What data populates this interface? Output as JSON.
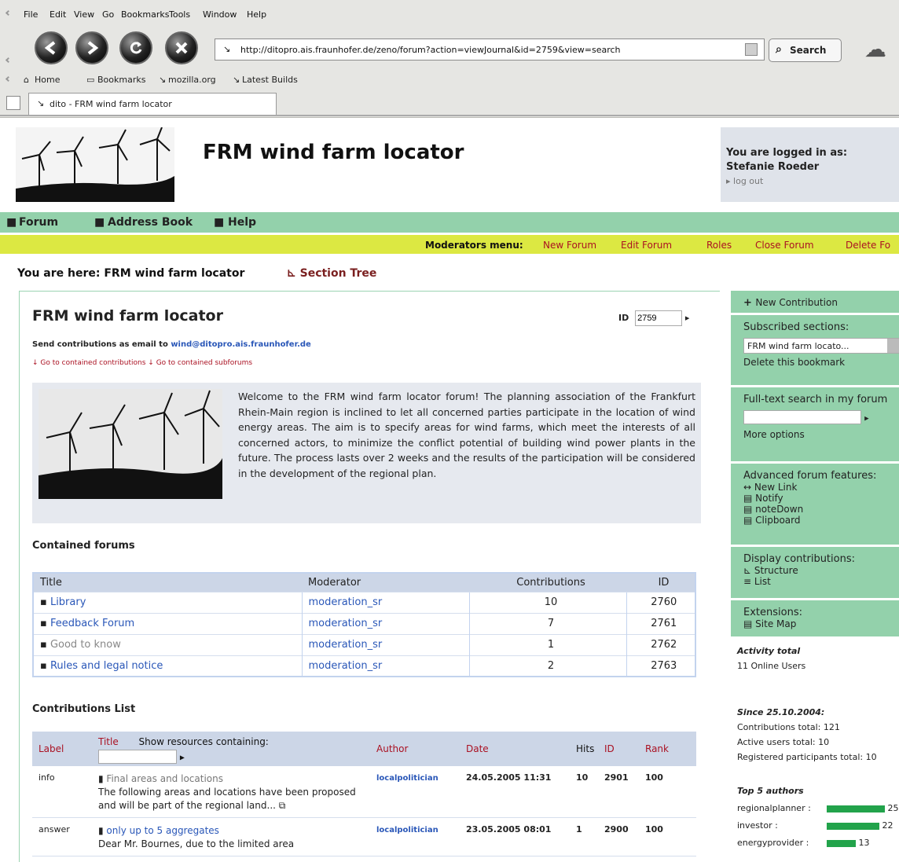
{
  "browser": {
    "menu": [
      "File",
      "Edit",
      "View",
      "Go",
      "Bookmarks",
      "Tools",
      "Window",
      "Help"
    ],
    "url": "http://ditopro.ais.fraunhofer.de/zeno/forum?action=viewJournal&id=2759&view=search",
    "search_label": "Search",
    "personal": [
      "Home",
      "Bookmarks",
      "mozilla.org",
      "Latest Builds"
    ],
    "tab_title": "dito - FRM wind farm locator"
  },
  "header": {
    "title": "FRM wind farm locator",
    "login_label": "You are logged in as:",
    "user": "Stefanie Roeder",
    "logout": "log out"
  },
  "nav": [
    "Forum",
    "Address Book",
    "Help"
  ],
  "moderators": {
    "label": "Moderators menu:",
    "items": [
      "New Forum",
      "Edit Forum",
      "Roles",
      "Close Forum",
      "Delete Fo"
    ]
  },
  "breadcrumb": {
    "here": "You are here: FRM wind farm locator",
    "tree": "Section Tree"
  },
  "forum": {
    "title": "FRM wind farm locator",
    "id_label": "ID",
    "id_value": "2759",
    "email_prefix": "Send contributions as email to",
    "email": "wind@ditopro.ais.fraunhofer.de",
    "goto1": "Go to contained contributions",
    "goto2": "Go to contained subforums",
    "welcome": "Welcome to the FRM wind farm locator forum! The planning association of the Frankfurt Rhein-Main region is inclined to let all concerned parties participate in the location of wind energy areas. The aim is to specify areas for wind farms, which meet the interests of all concerned actors, to minimize the conflict potential of building wind power plants in the future. The process lasts over 2 weeks and the results of the participation will be considered in the development of the regional plan."
  },
  "contained": {
    "heading": "Contained forums",
    "headers": {
      "title": "Title",
      "moderator": "Moderator",
      "contributions": "Contributions",
      "id": "ID"
    },
    "rows": [
      {
        "title": "Library",
        "moderator": "moderation_sr",
        "contributions": "10",
        "id": "2760"
      },
      {
        "title": "Feedback Forum",
        "moderator": "moderation_sr",
        "contributions": "7",
        "id": "2761"
      },
      {
        "title": "Good to know",
        "moderator": "moderation_sr",
        "contributions": "1",
        "id": "2762"
      },
      {
        "title": "Rules and legal notice",
        "moderator": "moderation_sr",
        "contributions": "2",
        "id": "2763"
      }
    ]
  },
  "contributions": {
    "heading": "Contributions List",
    "headers": {
      "label": "Label",
      "title": "Title",
      "show": "Show resources containing:",
      "author": "Author",
      "date": "Date",
      "hits": "Hits",
      "id": "ID",
      "rank": "Rank"
    },
    "rows": [
      {
        "label": "info",
        "title": "Final areas and locations",
        "snippet": "The following areas and locations have been proposed and will be part of the regional land...",
        "author": "localpolitician",
        "date": "24.05.2005 11:31",
        "hits": "10",
        "id": "2901",
        "rank": "100"
      },
      {
        "label": "answer",
        "title": "only up to 5 aggregates",
        "snippet": "Dear Mr. Bournes, due to the limited area",
        "author": "localpolitician",
        "date": "23.05.2005 08:01",
        "hits": "1",
        "id": "2900",
        "rank": "100"
      }
    ]
  },
  "sidebar": {
    "new_contribution": "New Contribution",
    "subscribed": "Subscribed sections:",
    "subscribed_value": "FRM wind farm locato...",
    "delete_bookmark": "Delete this bookmark",
    "fulltext": "Full-text search in my forum",
    "more_options": "More options",
    "advanced": "Advanced forum features:",
    "advanced_items": [
      "New Link",
      "Notify",
      "noteDown",
      "Clipboard"
    ],
    "display": "Display contributions:",
    "display_items": [
      "Structure",
      "List"
    ],
    "extensions": "Extensions:",
    "site_map": "Site Map",
    "activity": "Activity total",
    "online": "11 Online Users",
    "since": "Since 25.10.2004:",
    "contrib_total": "Contributions total: 121",
    "active_users": "Active users total: 10",
    "registered": "Registered participants total: 10",
    "top": "Top 5 authors",
    "authors": [
      {
        "name": "regionalplanner :",
        "count": "25",
        "fill": 1.0
      },
      {
        "name": "investor :",
        "count": "22",
        "fill": 0.9
      },
      {
        "name": "energyprovider :",
        "count": "13",
        "fill": 0.5
      }
    ]
  }
}
